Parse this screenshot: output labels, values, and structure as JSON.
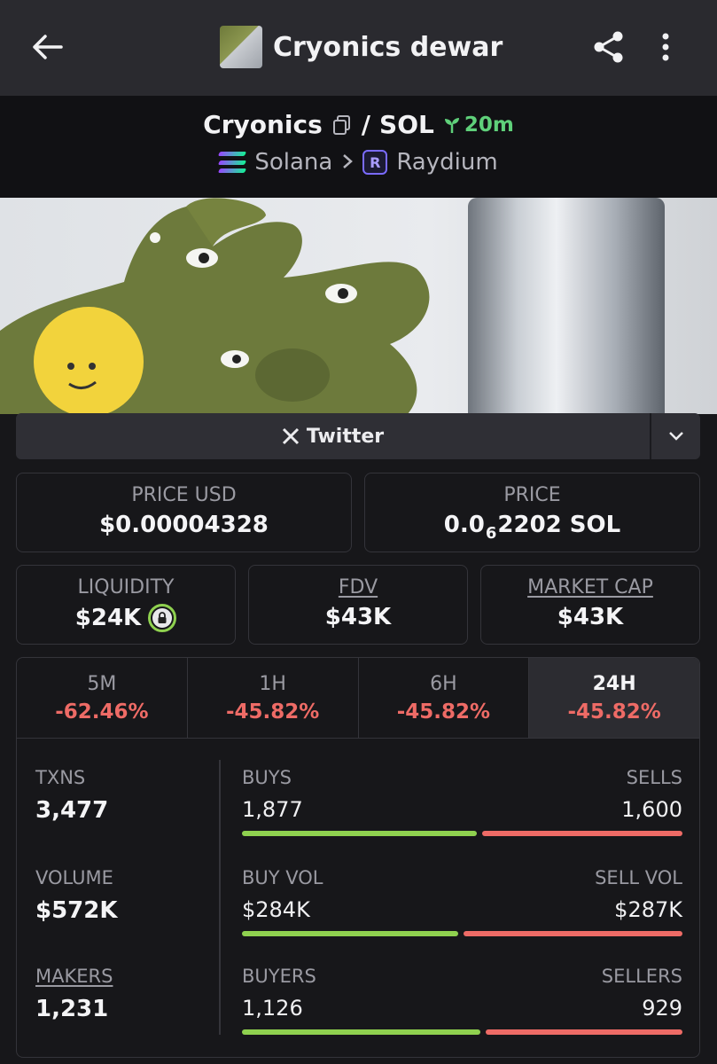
{
  "header": {
    "title": "Cryonics dewar"
  },
  "pair": {
    "base": "Cryonics",
    "separator": "/",
    "quote": "SOL",
    "age": "20m",
    "chain": "Solana",
    "dex": "Raydium"
  },
  "links": {
    "twitter": "Twitter"
  },
  "stats": {
    "price_usd_label": "PRICE USD",
    "price_usd": "$0.00004328",
    "price_label": "PRICE",
    "price_prefix": "0.0",
    "price_sub": "6",
    "price_suffix": "2202 SOL",
    "liquidity_label": "LIQUIDITY",
    "liquidity": "$24K",
    "fdv_label": "FDV",
    "fdv": "$43K",
    "mcap_label": "MARKET CAP",
    "mcap": "$43K"
  },
  "timeframes": [
    {
      "label": "5M",
      "change": "-62.46%"
    },
    {
      "label": "1H",
      "change": "-45.82%"
    },
    {
      "label": "6H",
      "change": "-45.82%"
    },
    {
      "label": "24H",
      "change": "-45.82%"
    }
  ],
  "active_timeframe": "24H",
  "activity": {
    "txns_label": "TXNS",
    "txns": "3,477",
    "volume_label": "VOLUME",
    "volume": "$572K",
    "makers_label": "MAKERS",
    "makers": "1,231",
    "buys_label": "BUYS",
    "buys": "1,877",
    "sells_label": "SELLS",
    "sells": "1,600",
    "buy_vol_label": "BUY VOL",
    "buy_vol": "$284K",
    "sell_vol_label": "SELL VOL",
    "sell_vol": "$287K",
    "buyers_label": "BUYERS",
    "buyers": "1,126",
    "sellers_label": "SELLERS",
    "sellers": "929"
  },
  "ratios": {
    "buys_share": 0.54,
    "buy_vol_share": 0.497,
    "buyers_share": 0.548
  },
  "colors": {
    "positive": "#8fd14f",
    "negative": "#ee6b66",
    "age": "#5fd07a"
  }
}
